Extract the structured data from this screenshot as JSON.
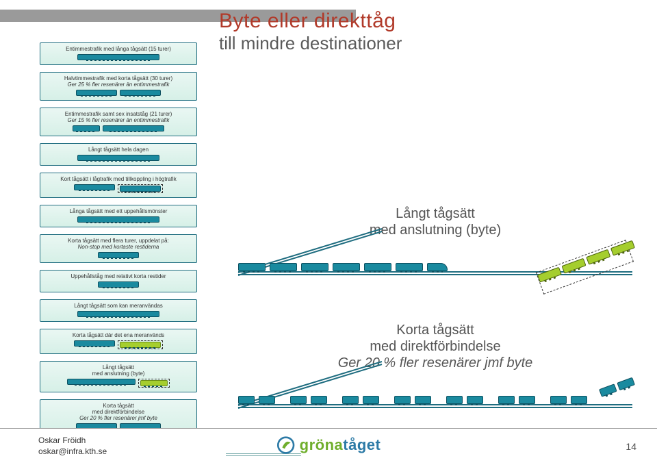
{
  "title": {
    "line1": "Byte eller direkttåg",
    "line2": "till mindre destinationer"
  },
  "leftPanels": [
    {
      "caption": "Entimmestrafik med långa tågsätt (15 turer)",
      "shape": "one-long"
    },
    {
      "caption": "Halvtimmestrafik med korta tågsätt (30 turer)",
      "sub": "Ger 25 % fler resenärer än entimmestrafik",
      "shape": "two-short",
      "subItalic": true
    },
    {
      "caption": "Entimmestrafik samt sex insatståg (21 turer)",
      "sub": "Ger 15 % fler resenärer än entimmestrafik",
      "shape": "short-plus-long",
      "subItalic": true
    },
    {
      "caption": "Långt tågsätt hela dagen",
      "shape": "one-long"
    },
    {
      "caption": "Kort tågsätt i lågtrafik med tillkoppling i högtrafik",
      "shape": "short-plus-dashed-short"
    },
    {
      "caption": "Långa tågsätt med ett uppehållsmönster",
      "shape": "one-long"
    },
    {
      "caption": "Korta tågsätt med flera turer, uppdelat på:",
      "sub": "Non-stop med kortaste restiderna",
      "shape": "one-short",
      "subItalic": true
    },
    {
      "caption": "Uppehållståg med relativt korta restider",
      "shape": "one-short"
    },
    {
      "caption": "Långt tågsätt som kan meranvändas",
      "shape": "one-long"
    },
    {
      "caption": "Korta tågsätt där det ena meranvänds",
      "shape": "short-plus-dashed-green"
    },
    {
      "caption": "Långt tågsätt",
      "sub": "med anslutning (byte)",
      "shape": "long-plus-dashed-green"
    },
    {
      "caption": "Korta tågsätt",
      "sub": "med direktförbindelse",
      "sub2": "Ger 20 % fler resenärer jmf byte",
      "shape": "two-short",
      "sub2Italic": true
    }
  ],
  "fig1": {
    "line1": "Långt tågsätt",
    "line2": "med anslutning (byte)",
    "mainCars": 7,
    "branchCars": 4,
    "dashedPlatform": true
  },
  "fig2": {
    "line1": "Korta tågsätt",
    "line2": "med direktförbindelse",
    "line3": "Ger 20 % fler resenärer jmf byte",
    "pairs": 7,
    "branchPairCars": 2
  },
  "footer": {
    "authorName": "Oskar Fröidh",
    "authorEmail": "oskar@infra.kth.se",
    "logoPart1": "gröna",
    "logoPart2": "tåget",
    "slideNum": "14"
  }
}
